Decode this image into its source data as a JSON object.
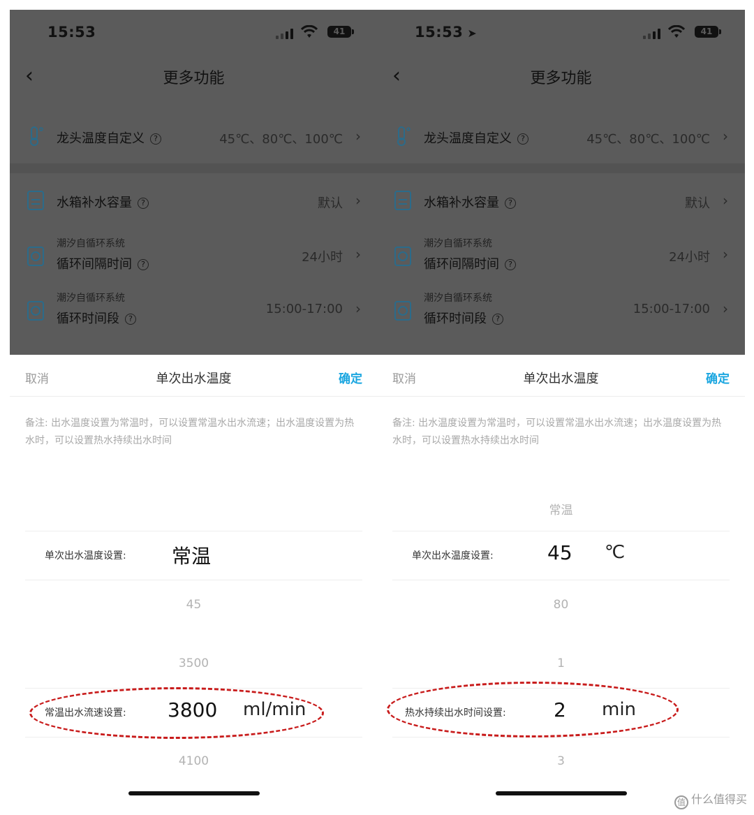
{
  "left": {
    "status": {
      "time": "15:53",
      "battery": "41"
    },
    "nav": {
      "back": "‹",
      "title": "更多功能"
    },
    "settings": [
      {
        "label": "龙头温度自定义",
        "value": "45℃、80℃、100℃"
      },
      {
        "label": "水箱补水容量",
        "value": "默认"
      },
      {
        "sublabel": "潮汐自循环系统",
        "label": "循环间隔时间",
        "value": "24小时"
      },
      {
        "sublabel": "潮汐自循环系统",
        "label": "循环时间段",
        "value": "15:00-17:00"
      }
    ],
    "sheet": {
      "cancel": "取消",
      "title": "单次出水温度",
      "confirm": "确定",
      "note": "备注: 出水温度设置为常温时，可以设置常温水出水流速；出水温度设置为热水时，可以设置热水持续出水时间",
      "temp_label": "单次出水温度设置:",
      "temp_value": "常温",
      "temp_next": "45",
      "flow_prev": "3500",
      "flow_label": "常温出水流速设置:",
      "flow_value": "3800",
      "flow_unit": "ml/min",
      "flow_next": "4100"
    }
  },
  "right": {
    "status": {
      "time": "15:53",
      "battery": "41"
    },
    "nav": {
      "back": "‹",
      "title": "更多功能"
    },
    "settings": [
      {
        "label": "龙头温度自定义",
        "value": "45℃、80℃、100℃"
      },
      {
        "label": "水箱补水容量",
        "value": "默认"
      },
      {
        "sublabel": "潮汐自循环系统",
        "label": "循环间隔时间",
        "value": "24小时"
      },
      {
        "sublabel": "潮汐自循环系统",
        "label": "循环时间段",
        "value": "15:00-17:00"
      }
    ],
    "sheet": {
      "cancel": "取消",
      "title": "单次出水温度",
      "confirm": "确定",
      "note": "备注: 出水温度设置为常温时，可以设置常温水出水流速；出水温度设置为热水时，可以设置热水持续出水时间",
      "temp_prev": "常温",
      "temp_label": "单次出水温度设置:",
      "temp_value": "45",
      "temp_unit": "℃",
      "temp_next": "80",
      "time_prev": "1",
      "time_label": "热水持续出水时间设置:",
      "time_value": "2",
      "time_unit": "min",
      "time_next": "3"
    }
  },
  "watermark": {
    "icon": "值",
    "text": "什么值得买"
  },
  "colors": {
    "accent": "#1aa6e0",
    "highlight": "#c81b1b",
    "overlay": "#5b5b5b"
  }
}
